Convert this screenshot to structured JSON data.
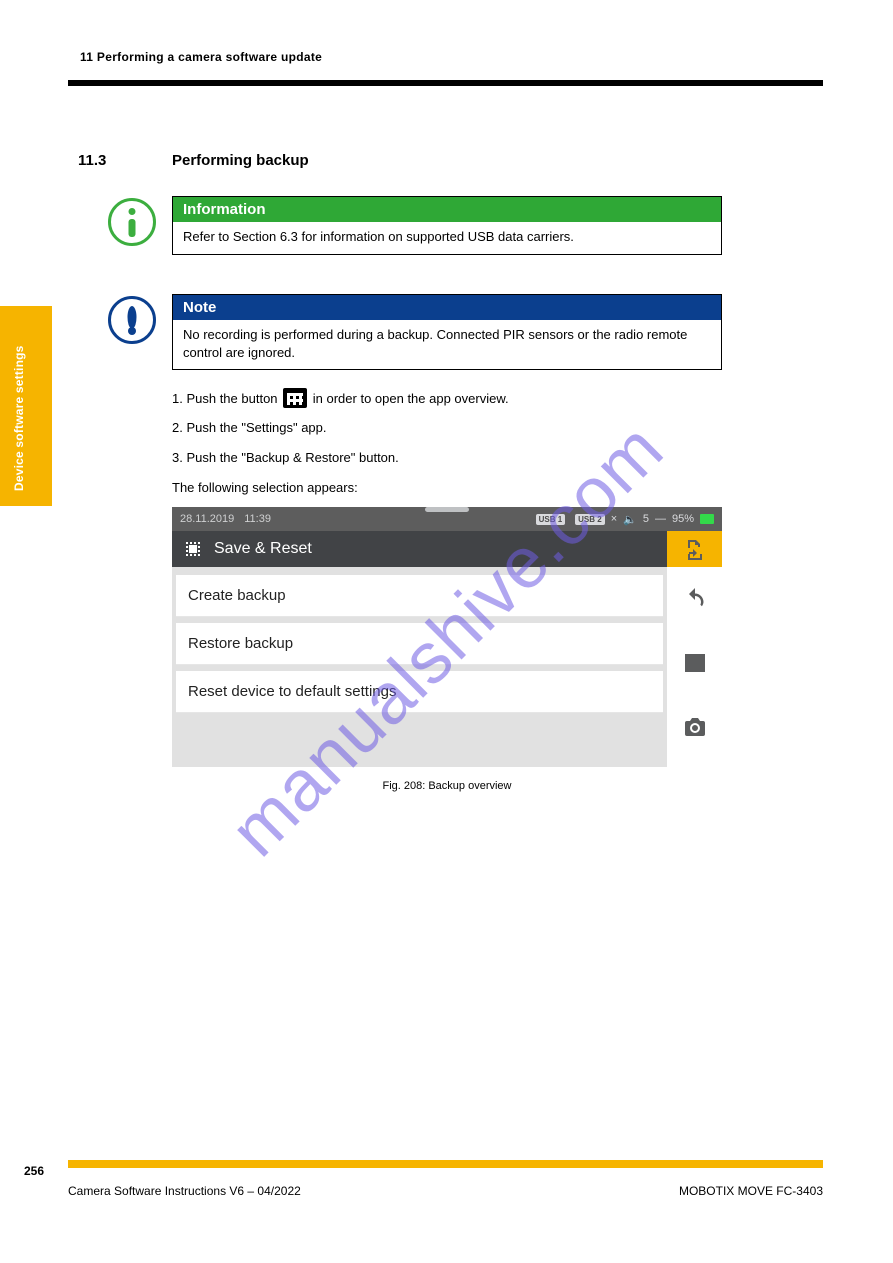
{
  "page": {
    "header": "11 Performing a camera software update",
    "number": "256",
    "footer_left": "Camera Software Instructions V6 – 04/2022",
    "footer_right": "MOBOTIX MOVE FC-3403"
  },
  "sidebar_tab": "Device software settings",
  "section": {
    "number": "11.3",
    "title": "Performing backup"
  },
  "info": {
    "head": "Information",
    "body": "Refer to Section 6.3 for information on supported USB data carriers."
  },
  "note": {
    "head": "Note",
    "body": "No recording is performed during a backup. Connected PIR sensors or the radio remote control are ignored."
  },
  "steps": {
    "line1_pre": "1. Push the button ",
    "line1_post": " in order to open the app overview.",
    "line2": "2. Push the \"Settings\" app.",
    "line3": "3. Push the \"Backup & Restore\" button.",
    "line4": "The following selection appears:"
  },
  "screenshot": {
    "status": {
      "date": "28.11.2019",
      "time": "11:39",
      "usb1": "USB 1",
      "usb2": "USB 2",
      "x": "×",
      "vol": "5",
      "battery": "95%"
    },
    "title": "Save & Reset",
    "rows": [
      "Create backup",
      "Restore backup",
      "Reset device to default settings"
    ]
  },
  "caption": "Fig. 208: Backup overview",
  "watermark": "manualshive.com"
}
